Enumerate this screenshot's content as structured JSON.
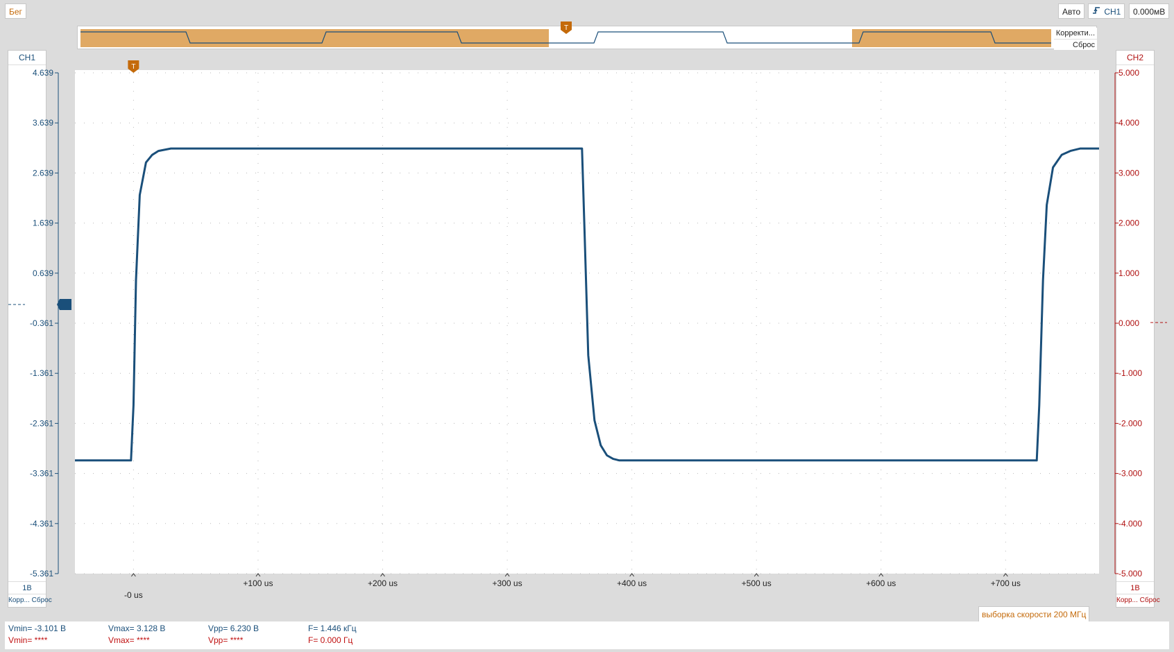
{
  "toolbar": {
    "run_label": "Бег",
    "mode_label": "Авто",
    "trigger_channel_label": "CH1",
    "trigger_level_label": "0.000мВ"
  },
  "overview": {
    "correction_label": "Корректи...",
    "reset_label": "Сброс"
  },
  "ch1": {
    "label": "CH1",
    "scale": "1В",
    "correction_label": "Корр...",
    "reset_label": "Сброс",
    "color": "#1a4f7a"
  },
  "ch2": {
    "label": "CH2",
    "scale": "1В",
    "correction_label": "Корр...",
    "reset_label": "Сброс",
    "color": "#c01010"
  },
  "trigger_marker": "T",
  "sample_rate_label": "выборка скорости 200 МГц",
  "measurements": {
    "ch1": {
      "vmin": "Vmin= -3.101 В",
      "vmax": "Vmax= 3.128 В",
      "vpp": "Vpp= 6.230 В",
      "freq": "F= 1.446 кГц"
    },
    "ch2": {
      "vmin": "Vmin= ****",
      "vmax": "Vmax= ****",
      "vpp": "Vpp= ****",
      "freq": "F= 0.000 Гц"
    }
  },
  "chart_data": {
    "type": "line",
    "x_unit": "us",
    "x_range": [
      -47,
      775
    ],
    "x_ticks": [
      0,
      100,
      200,
      300,
      400,
      500,
      600,
      700
    ],
    "x_tick_labels": [
      "-0 us",
      "+100 us",
      "+200 us",
      "+300 us",
      "+400 us",
      "+500 us",
      "+600 us",
      "+700 us"
    ],
    "y_left_range": [
      -5.361,
      4.639
    ],
    "y_left_ticks": [
      "4.639",
      "3.639",
      "2.639",
      "1.639",
      "0.639",
      "-0.361",
      "-1.361",
      "-2.361",
      "-3.361",
      "-4.361",
      "-5.361"
    ],
    "y_right_range": [
      -5.0,
      5.0
    ],
    "y_right_ticks": [
      "5.000",
      "4.000",
      "3.000",
      "2.000",
      "1.000",
      "0.000",
      "-1.000",
      "-2.000",
      "-3.000",
      "-4.000",
      "-5.000"
    ],
    "grid": true,
    "series": [
      {
        "name": "CH1",
        "color": "#1a4f7a",
        "x": [
          -47,
          -2,
          0,
          2,
          5,
          10,
          15,
          20,
          30,
          360,
          362,
          365,
          370,
          375,
          380,
          385,
          390,
          725,
          727,
          730,
          733,
          738,
          745,
          752,
          760,
          775
        ],
        "y": [
          -3.101,
          -3.101,
          -2.0,
          0.5,
          2.2,
          2.85,
          3.0,
          3.08,
          3.128,
          3.128,
          1.5,
          -1.0,
          -2.3,
          -2.8,
          -3.0,
          -3.07,
          -3.101,
          -3.101,
          -2.0,
          0.5,
          2.0,
          2.75,
          3.0,
          3.08,
          3.128,
          3.128
        ]
      }
    ]
  }
}
